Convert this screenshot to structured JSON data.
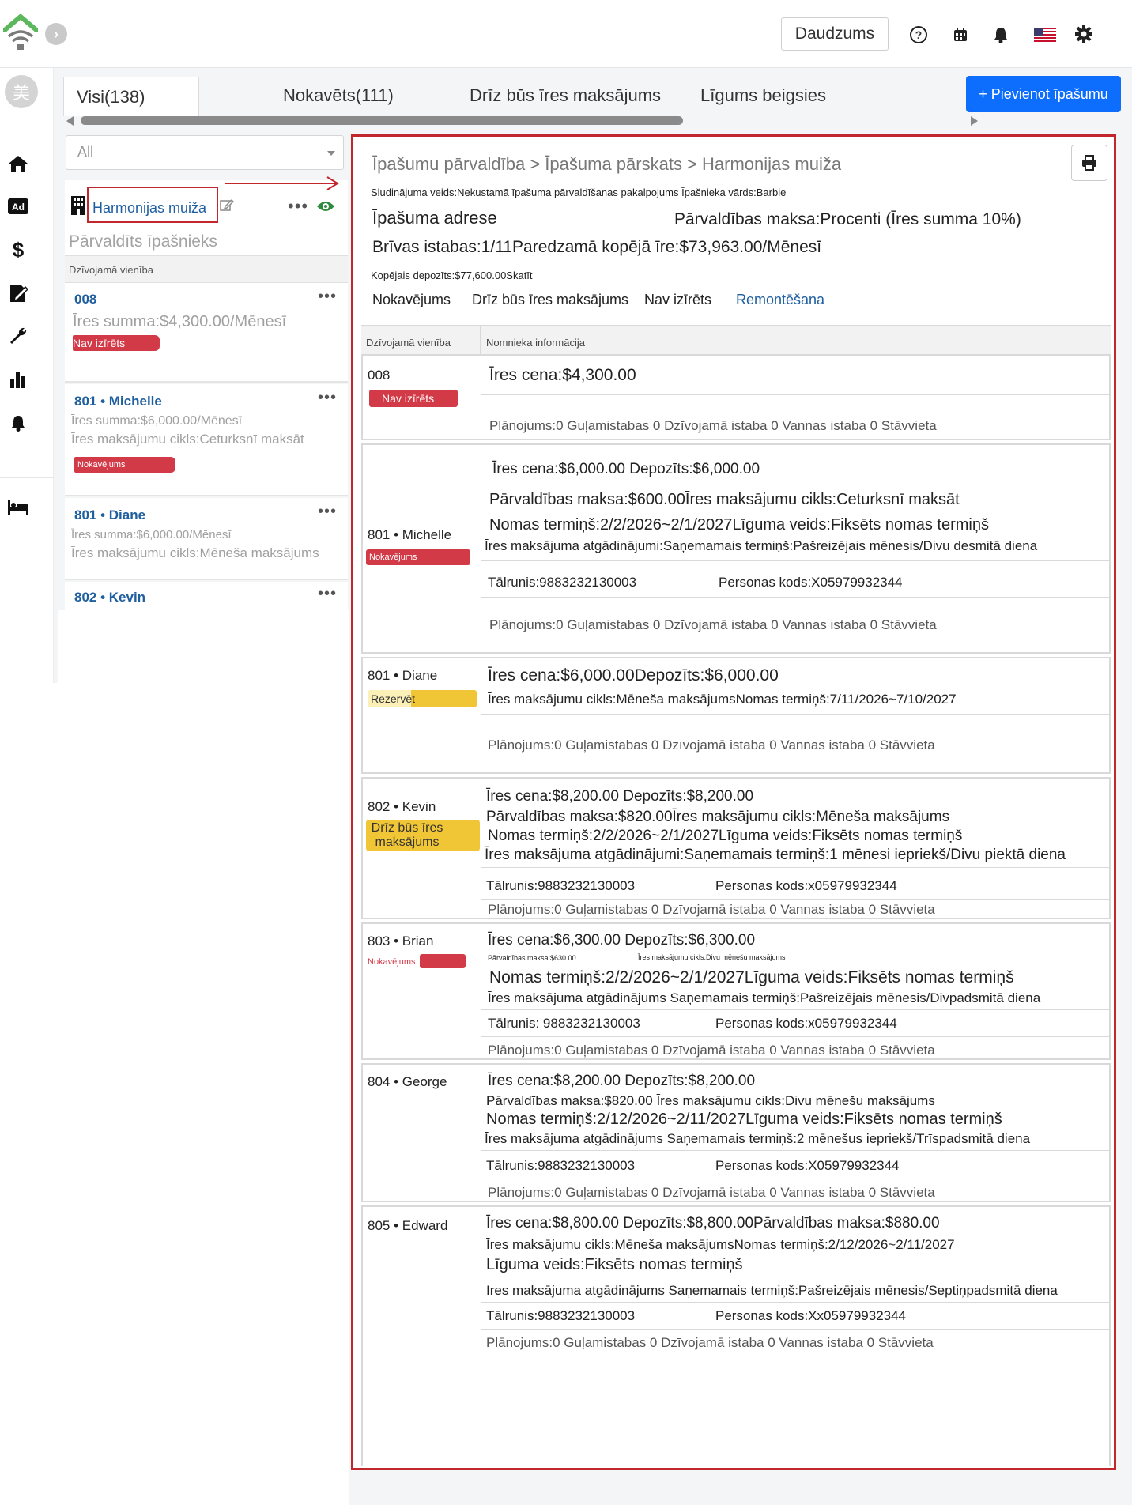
{
  "topbar": {
    "daudzums_label": "Daudzums",
    "avatar_text": "美"
  },
  "tabs": [
    {
      "label": "Visi(138)"
    },
    {
      "label": "Nokavēts(111)"
    },
    {
      "label": "Drīz būs īres maksājums"
    },
    {
      "label": "Līgums beigsies"
    }
  ],
  "add_button": "+ Pievienot īpašumu",
  "filter": {
    "value": "All"
  },
  "property": {
    "name": "Harmonijas muiža",
    "subtitle": "Pārvaldīts īpašnieks",
    "section_header": "Dzīvojamā vienība"
  },
  "left_units": [
    {
      "title": "008",
      "line1": "Īres summa:$4,300.00/Mēnesī",
      "line2": "",
      "badge": "Nav izīrēts"
    },
    {
      "title": "801 • Michelle",
      "line1": "Īres summa:$6,000.00/Mēnesī",
      "line2": "Īres maksājumu cikls:Ceturksnī maksāt",
      "badge": "Nokavējums"
    },
    {
      "title": "801 • Diane",
      "line1": "Īres summa:$6,000.00/Mēnesī",
      "line2": "Īres maksājumu cikls:Mēneša maksājums",
      "badge": ""
    },
    {
      "title": "802 • Kevin",
      "line1": "",
      "line2": "",
      "badge": ""
    }
  ],
  "main": {
    "breadcrumb": "Īpašumu pārvaldība > Īpašuma pārskats > Harmonijas muiža",
    "listing_info": "Sludinājuma veids:Nekustamā īpašuma pārvaldīšanas pakalpojums Īpašnieka vārds:Barbie",
    "address_label": "Īpašuma adrese",
    "fee_label": "Pārvaldības maksa:Procenti (Īres summa 10%)",
    "rooms_label": "Brīvas istabas:1/11Paredzamā kopējā īre:$73,963.00/Mēnesī",
    "deposit_label": "Kopējais depozīts:$77,600.00Skatīt",
    "filters": [
      "Nokavējums",
      "Drīz būs īres maksājums",
      "Nav izīrēts",
      "Remontēšana"
    ],
    "col_unit": "Dzīvojamā vienība",
    "col_tenant": "Nomnieka informācija"
  },
  "units": [
    {
      "name": "008",
      "badge": "Nav izīrēts",
      "l1": "Īres cena:$4,300.00",
      "l2": "",
      "plan": "Plānojums:0 Guļamistabas 0 Dzīvojamā istaba 0 Vannas istaba 0 Stāvvieta"
    },
    {
      "name": "801 • Michelle",
      "badge": "Nokavējums",
      "l1": "Īres cena:$6,000.00  Depozīts:$6,000.00",
      "l2": "Pārvaldības maksa:$600.00Īres maksājumu cikls:Ceturksnī maksāt",
      "l3": "Nomas termiņš:2/2/2026~2/1/2027Līguma veids:Fiksēts nomas termiņš",
      "l4": "Īres maksājuma atgādinājumi:Saņemamais termiņš:Pašreizējais mēnesis/Divu desmitā diena",
      "phone": "Tālrunis:9883232130003",
      "pid": "Personas kods:X05979932344",
      "plan": "Plānojums:0 Guļamistabas 0 Dzīvojamā istaba 0 Vannas istaba 0 Stāvvieta"
    },
    {
      "name": "801 • Diane",
      "badge": "Rezervēt",
      "l1": "Īres cena:$6,000.00Depozīts:$6,000.00",
      "l2": "Īres maksājumu cikls:Mēneša maksājumsNomas termiņš:7/11/2026~7/10/2027",
      "plan": "Plānojums:0 Guļamistabas 0 Dzīvojamā istaba 0 Vannas istaba 0 Stāvvieta"
    },
    {
      "name": "802 • Kevin",
      "badge": "Drīz būs īres maksājums",
      "l1": "Īres cena:$8,200.00  Depozīts:$8,200.00",
      "l2": "Pārvaldības maksa:$820.00Īres maksājumu cikls:Mēneša maksājums",
      "l3": "Nomas termiņš:2/2/2026~2/1/2027Līguma veids:Fiksēts nomas termiņš",
      "l4": "Īres maksājuma atgādinājumi:Saņemamais termiņš:1 mēnesi iepriekš/Divu piektā diena",
      "phone": "Tālrunis:9883232130003",
      "pid": "Personas kods:x05979932344",
      "plan": "Plānojums:0 Guļamistabas 0 Dzīvojamā istaba 0 Vannas istaba 0 Stāvvieta"
    },
    {
      "name": "803 • Brian",
      "badge": "Nokavējums",
      "l1": "Īres cena:$6,300.00  Depozīts:$6,300.00",
      "l2a": "Pārvaldības maksa:$630.00",
      "l2b": "Īres maksājumu cikls:Divu mēnešu maksājums",
      "l3": "Nomas termiņš:2/2/2026~2/1/2027Līguma veids:Fiksēts nomas termiņš",
      "l4": "Īres maksājuma atgādinājums   Saņemamais termiņš:Pašreizējais mēnesis/Divpadsmitā diena",
      "phone": "Tālrunis: 9883232130003",
      "pid": "Personas kods:x05979932344",
      "plan": "Plānojums:0 Guļamistabas 0 Dzīvojamā istaba 0 Vannas istaba 0 Stāvvieta"
    },
    {
      "name": "804 • George",
      "badge": "",
      "l1": "Īres cena:$8,200.00  Depozīts:$8,200.00",
      "l2": "Pārvaldības maksa:$820.00 Īres maksājumu cikls:Divu mēnešu maksājums",
      "l3": "Nomas termiņš:2/12/2026~2/11/2027Līguma veids:Fiksēts nomas termiņš",
      "l4": "Īres maksājuma atgādinājums   Saņemamais termiņš:2 mēnešus iepriekš/Trīspadsmitā diena",
      "phone": "Tālrunis:9883232130003",
      "pid": "Personas kods:X05979932344",
      "plan": "Plānojums:0 Guļamistabas 0 Dzīvojamā istaba 0 Vannas istaba 0 Stāvvieta"
    },
    {
      "name": "805 • Edward",
      "badge": "",
      "l1": "Īres cena:$8,800.00  Depozīts:$8,800.00Pārvaldības maksa:$880.00",
      "l2": "Īres maksājumu cikls:Mēneša maksājumsNomas termiņš:2/12/2026~2/11/2027",
      "l3": "Līguma veids:Fiksēts nomas termiņš",
      "l4": "Īres maksājuma atgādinājums   Saņemamais termiņš:Pašreizējais mēnesis/Septiņpadsmitā diena",
      "phone": "Tālrunis:9883232130003",
      "pid": "Personas kods:Xx05979932344",
      "plan": "Plānojums:0 Guļamistabas 0 Dzīvojamā istaba 0 Vannas istaba 0 Stāvvieta"
    }
  ],
  "colors": {
    "accent": "#0d6efd",
    "alert_red": "#d33a48",
    "highlight_border": "#c1272d",
    "warning_yellow": "#f0c536",
    "eye_green": "#2e8b3d"
  }
}
